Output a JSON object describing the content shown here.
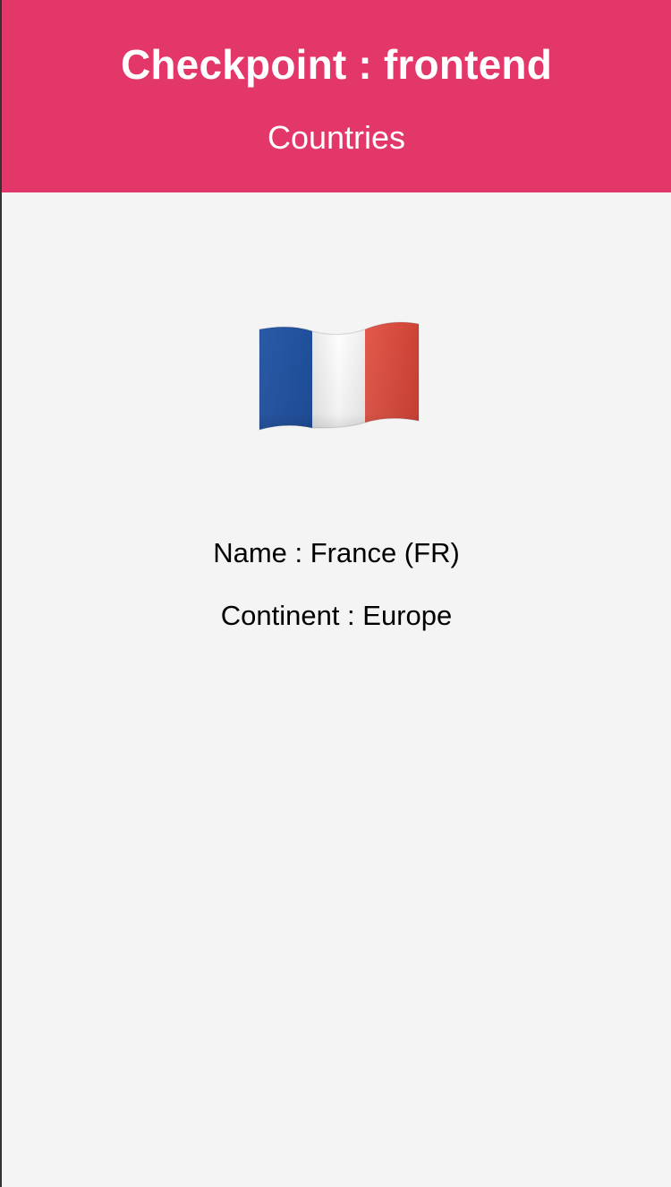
{
  "header": {
    "title": "Checkpoint : frontend",
    "nav_link": "Countries",
    "background": "#e3376a"
  },
  "country": {
    "flag_icon": "france-flag-icon",
    "flag_colors": [
      "#1f4f9c",
      "#ffffff",
      "#dc4c40"
    ],
    "name_line": "Name : France (FR)",
    "continent_line": "Continent : Europe"
  }
}
